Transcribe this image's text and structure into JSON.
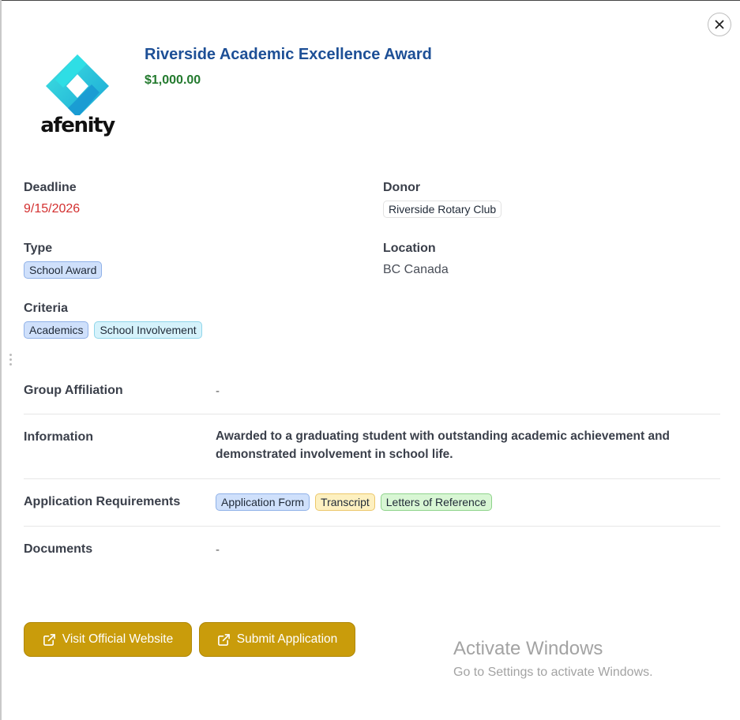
{
  "award": {
    "title": "Riverside Academic Excellence Award",
    "amount": "$1,000.00",
    "logo_text": "afenity"
  },
  "details": {
    "deadline_label": "Deadline",
    "deadline_value": "9/15/2026",
    "donor_label": "Donor",
    "donor_value": "Riverside Rotary Club",
    "type_label": "Type",
    "type_value": "School Award",
    "location_label": "Location",
    "location_value": "BC Canada",
    "criteria_label": "Criteria",
    "criteria": [
      "Academics",
      "School Involvement"
    ]
  },
  "rows": {
    "group_label": "Group Affiliation",
    "group_value": "-",
    "info_label": "Information",
    "info_value": "Awarded to a graduating student with outstanding academic achievement and demonstrated involvement in school life.",
    "req_label": "Application Requirements",
    "requirements": [
      "Application Form",
      "Transcript",
      "Letters of Reference"
    ],
    "docs_label": "Documents",
    "docs_value": "-"
  },
  "actions": {
    "website_label": "Visit Official Website",
    "submit_label": "Submit Application"
  },
  "watermark": {
    "title": "Activate Windows",
    "subtitle": "Go to Settings to activate Windows."
  },
  "icons": {
    "close": "close-icon",
    "external": "external-link-icon",
    "logo": "afenity-logo"
  },
  "colors": {
    "title": "#1d4f96",
    "amount": "#237a2e",
    "deadline": "#d32f2f",
    "button": "#c99c0b"
  }
}
